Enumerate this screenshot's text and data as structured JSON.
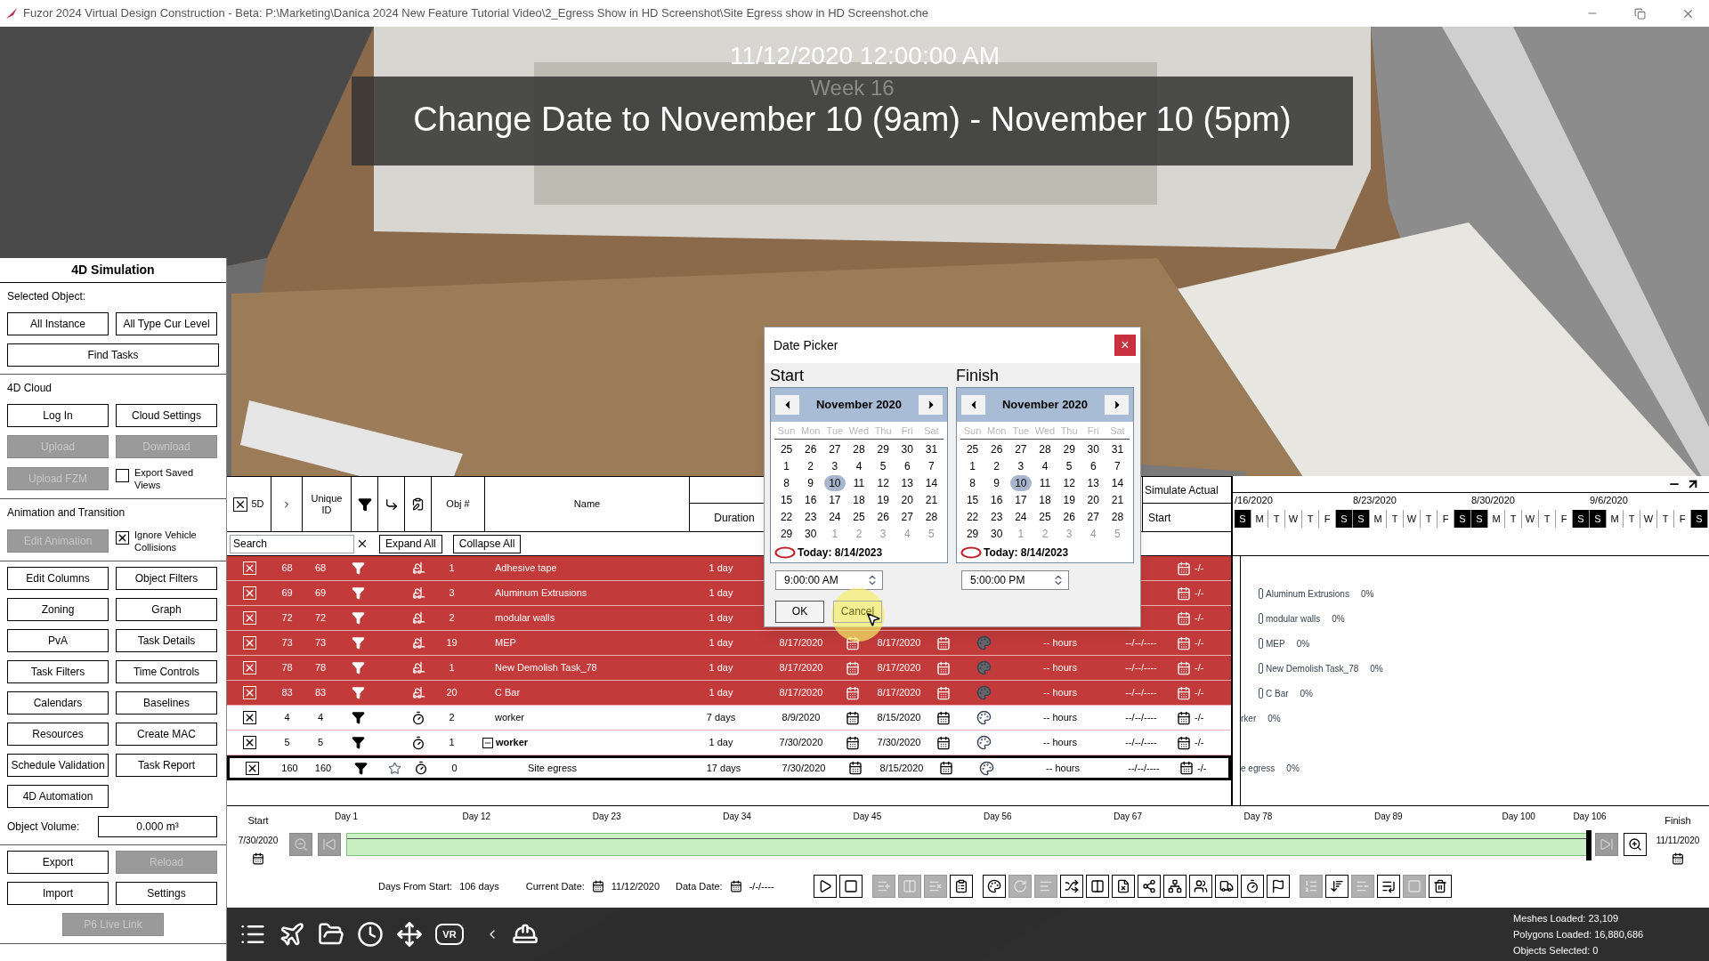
{
  "window": {
    "title": "Fuzor 2024 Virtual Design Construction - Beta: P:\\Marketing\\Danica 2024 New Feature Tutorial Video\\2_Egress Show in HD Screenshot\\Site Egress show in HD Screenshot.che"
  },
  "viewport": {
    "date": "11/12/2020 12:00:00 AM",
    "week": "Week 16",
    "banner": "Change Date to November 10 (9am) - November 10 (5pm)"
  },
  "left_panel": {
    "title": "4D Simulation",
    "sections": [
      {
        "heading": "Selected Object:",
        "rows": [
          {
            "items": [
              {
                "kind": "button",
                "label": "All Instance",
                "disabled": false
              },
              {
                "kind": "button",
                "label": "All Type Cur Level",
                "disabled": false
              }
            ]
          },
          {
            "items": [
              {
                "kind": "wide-button",
                "label": "Find Tasks",
                "disabled": false
              }
            ]
          }
        ]
      },
      {
        "heading": "4D Cloud",
        "rows": [
          {
            "items": [
              {
                "kind": "button",
                "label": "Log In",
                "disabled": false
              },
              {
                "kind": "button",
                "label": "Cloud Settings",
                "disabled": false
              }
            ]
          },
          {
            "items": [
              {
                "kind": "button",
                "label": "Upload",
                "disabled": true
              },
              {
                "kind": "button",
                "label": "Download",
                "disabled": true
              }
            ]
          },
          {
            "items": [
              {
                "kind": "button",
                "label": "Upload FZM",
                "disabled": true
              },
              {
                "kind": "checkbox",
                "label": "Export Saved Views",
                "checked": false
              }
            ]
          }
        ]
      },
      {
        "heading": "Animation and Transition",
        "rows": [
          {
            "items": [
              {
                "kind": "button",
                "label": "Edit Animation",
                "disabled": true
              },
              {
                "kind": "checkbox",
                "label": "Ignore Vehicle Collisions",
                "checked": true
              }
            ]
          }
        ]
      },
      {
        "rows": [
          {
            "items": [
              {
                "kind": "button",
                "label": "Edit Columns",
                "disabled": false
              },
              {
                "kind": "button",
                "label": "Object Filters",
                "disabled": false
              }
            ]
          },
          {
            "items": [
              {
                "kind": "button",
                "label": "Zoning",
                "disabled": false
              },
              {
                "kind": "button",
                "label": "Graph",
                "disabled": false
              }
            ]
          },
          {
            "items": [
              {
                "kind": "button",
                "label": "PvA",
                "disabled": false
              },
              {
                "kind": "button",
                "label": "Task Details",
                "disabled": false
              }
            ]
          },
          {
            "items": [
              {
                "kind": "button",
                "label": "Task Filters",
                "disabled": false
              },
              {
                "kind": "button",
                "label": "Time Controls",
                "disabled": false
              }
            ]
          },
          {
            "items": [
              {
                "kind": "button",
                "label": "Calendars",
                "disabled": false
              },
              {
                "kind": "button",
                "label": "Baselines",
                "disabled": false
              }
            ]
          },
          {
            "items": [
              {
                "kind": "button",
                "label": "Resources",
                "disabled": false
              },
              {
                "kind": "button",
                "label": "Create MAC",
                "disabled": false
              }
            ]
          },
          {
            "items": [
              {
                "kind": "button",
                "label": "Schedule Validation",
                "disabled": false
              },
              {
                "kind": "button",
                "label": "Task Report",
                "disabled": false
              }
            ]
          },
          {
            "items": [
              {
                "kind": "button",
                "label": "4D Automation",
                "disabled": false
              }
            ]
          },
          {
            "items": [
              {
                "kind": "label",
                "label": "Object Volume:"
              },
              {
                "kind": "field",
                "value": "0.000 m³"
              }
            ]
          }
        ]
      },
      {
        "rows": [
          {
            "items": [
              {
                "kind": "button",
                "label": "Export",
                "disabled": false
              },
              {
                "kind": "button",
                "label": "Reload",
                "disabled": true
              }
            ]
          },
          {
            "items": [
              {
                "kind": "button",
                "label": "Import",
                "disabled": false
              },
              {
                "kind": "button",
                "label": "Settings",
                "disabled": false
              }
            ]
          },
          {
            "items": [
              {
                "kind": "centered-button",
                "label": "P6 Live Link",
                "disabled": true
              }
            ]
          }
        ]
      }
    ]
  },
  "table": {
    "header": {
      "checked": true,
      "col_5d": "5D",
      "unique_id": "Unique ID",
      "obj": "Obj #",
      "name": "Name",
      "duration": "Duration",
      "simulate_actual": "Simulate Actual",
      "start": "Start"
    },
    "search": {
      "placeholder": "Search"
    },
    "expand_all": "Expand All",
    "collapse_all": "Collapse All",
    "rows": [
      {
        "checked": true,
        "id": "68",
        "uid": "68",
        "kind": "equipment",
        "obj": "1",
        "name": "Adhesive tape",
        "duration": "1 day",
        "color": "#c23a3a",
        "selected": false,
        "tail": "-/-"
      },
      {
        "checked": true,
        "id": "69",
        "uid": "69",
        "kind": "equipment",
        "obj": "3",
        "name": "Aluminum Extrusions",
        "duration": "1 day",
        "color": "#c23a3a",
        "selected": false,
        "tail": "-/-",
        "gantt": {
          "label": "Aluminum Extrusions",
          "percent": "0%",
          "bar": true
        }
      },
      {
        "checked": true,
        "id": "72",
        "uid": "72",
        "kind": "equipment",
        "obj": "2",
        "name": "modular walls",
        "duration": "1 day",
        "color": "#c23a3a",
        "selected": false,
        "tail": "-/-",
        "gantt": {
          "label": "modular walls",
          "percent": "0%",
          "bar": true
        }
      },
      {
        "checked": true,
        "id": "73",
        "uid": "73",
        "kind": "equipment",
        "obj": "19",
        "name": "MEP",
        "duration": "1 day",
        "start": "8/17/2020",
        "finish": "8/17/2020",
        "hours": "-- hours",
        "actual": "--/--/----",
        "color": "#c23a3a",
        "selected": false,
        "tail": "-/-",
        "gantt": {
          "label": "MEP",
          "percent": "0%",
          "bar": true
        }
      },
      {
        "checked": true,
        "id": "78",
        "uid": "78",
        "kind": "equipment",
        "obj": "1",
        "name": "New Demolish Task_78",
        "duration": "1 day",
        "start": "8/17/2020",
        "finish": "8/17/2020",
        "hours": "-- hours",
        "actual": "--/--/----",
        "color": "#c23a3a",
        "selected": false,
        "tail": "-/-",
        "gantt": {
          "label": "New Demolish Task_78",
          "percent": "0%",
          "bar": true
        }
      },
      {
        "checked": true,
        "id": "83",
        "uid": "83",
        "kind": "equipment",
        "obj": "20",
        "name": "C Bar",
        "duration": "1 day",
        "start": "8/17/2020",
        "finish": "8/17/2020",
        "hours": "-- hours",
        "actual": "--/--/----",
        "color": "#c23a3a",
        "selected": false,
        "tail": "-/-",
        "gantt": {
          "label": "C Bar",
          "percent": "0%",
          "bar": true
        }
      },
      {
        "checked": true,
        "id": "4",
        "uid": "4",
        "kind": "labor",
        "obj": "2",
        "name": "worker",
        "duration": "7 days",
        "start": "8/9/2020",
        "finish": "8/15/2020",
        "hours": "-- hours",
        "actual": "--/--/----",
        "color": "#ffffff",
        "selected": false,
        "tail": "-/-",
        "gantt": {
          "label": "rker",
          "percent": "0%",
          "bar": false
        }
      },
      {
        "checked": true,
        "id": "5",
        "uid": "5",
        "kind": "labor",
        "obj": "1",
        "name": "worker",
        "duration": "1 day",
        "start": "7/30/2020",
        "finish": "7/30/2020",
        "hours": "-- hours",
        "actual": "--/--/----",
        "color": "#ffffff",
        "selected": false,
        "tail": "-/-",
        "expanded": true,
        "children": [
          {
            "checked": true,
            "id": "160",
            "uid": "160",
            "kind": "labor",
            "obj": "0",
            "name": "Site egress",
            "duration": "17 days",
            "start": "7/30/2020",
            "finish": "8/15/2020",
            "hours": "-- hours",
            "actual": "--/--/----",
            "color": "#ffffff",
            "selected": true,
            "tail": "-/-",
            "gantt": {
              "label": "e egress",
              "percent": "0%",
              "bar": false
            }
          }
        ]
      }
    ]
  },
  "gantt": {
    "dates": [
      "/16/2020",
      "8/23/2020",
      "8/30/2020",
      "9/6/2020"
    ],
    "days": [
      {
        "letter": "S",
        "weekend": true
      },
      {
        "letter": "M",
        "weekend": false
      },
      {
        "letter": "T",
        "weekend": false
      },
      {
        "letter": "W",
        "weekend": false
      },
      {
        "letter": "T",
        "weekend": false
      },
      {
        "letter": "F",
        "weekend": false
      },
      {
        "letter": "S",
        "weekend": true
      },
      {
        "letter": "S",
        "weekend": true
      },
      {
        "letter": "M",
        "weekend": false
      },
      {
        "letter": "T",
        "weekend": false
      },
      {
        "letter": "W",
        "weekend": false
      },
      {
        "letter": "T",
        "weekend": false
      },
      {
        "letter": "F",
        "weekend": false
      },
      {
        "letter": "S",
        "weekend": true
      },
      {
        "letter": "S",
        "weekend": true
      },
      {
        "letter": "M",
        "weekend": false
      },
      {
        "letter": "T",
        "weekend": false
      },
      {
        "letter": "W",
        "weekend": false
      },
      {
        "letter": "T",
        "weekend": false
      },
      {
        "letter": "F",
        "weekend": false
      },
      {
        "letter": "S",
        "weekend": true
      },
      {
        "letter": "S",
        "weekend": true
      },
      {
        "letter": "M",
        "weekend": false
      },
      {
        "letter": "T",
        "weekend": false
      },
      {
        "letter": "W",
        "weekend": false
      },
      {
        "letter": "T",
        "weekend": false
      },
      {
        "letter": "F",
        "weekend": false
      },
      {
        "letter": "S",
        "weekend": true
      }
    ]
  },
  "timeline": {
    "start_label": "Start",
    "start_date": "7/30/2020",
    "finish_label": "Finish",
    "finish_date": "11/11/2020",
    "level": 1,
    "ticks": [
      "Day 1",
      "Day 12",
      "Day 23",
      "Day 34",
      "Day 45",
      "Day 56",
      "Day 67",
      "Day 78",
      "Day 89",
      "Day 100",
      "Day 106"
    ],
    "nav": [
      {
        "kind": "zoom-out",
        "disabled": true
      },
      {
        "kind": "first",
        "disabled": true
      },
      {
        "kind": "last",
        "disabled": true
      },
      {
        "kind": "zoom-in",
        "disabled": false
      }
    ],
    "days_label": "Days From Start:",
    "days_value": "106 days",
    "current_label": "Current Date:",
    "current_value": "11/12/2020",
    "data_label": "Data Date:",
    "data_value": "-/-/----"
  },
  "toolbar": [
    {
      "kind": "play",
      "disabled": false
    },
    {
      "kind": "stop",
      "disabled": false
    },
    {
      "kind": "add-row",
      "disabled": true
    },
    {
      "kind": "remove-row",
      "disabled": true
    },
    {
      "kind": "delete-row",
      "disabled": true
    },
    {
      "kind": "task-list",
      "disabled": false
    },
    {
      "kind": "palette",
      "disabled": false
    },
    {
      "kind": "refresh",
      "disabled": true
    },
    {
      "kind": "lines",
      "disabled": true
    },
    {
      "kind": "shuffle",
      "disabled": false
    },
    {
      "kind": "columns",
      "disabled": false
    },
    {
      "kind": "file-x",
      "disabled": false
    },
    {
      "kind": "share",
      "disabled": false
    },
    {
      "kind": "network",
      "disabled": false
    },
    {
      "kind": "users",
      "disabled": false
    },
    {
      "kind": "truck",
      "disabled": false
    },
    {
      "kind": "timer",
      "disabled": false
    },
    {
      "kind": "flag",
      "disabled": false
    },
    {
      "kind": "ordered",
      "disabled": true
    },
    {
      "kind": "sort",
      "disabled": false
    },
    {
      "kind": "list-minus",
      "disabled": true
    },
    {
      "kind": "list-end",
      "disabled": false
    },
    {
      "kind": "square",
      "disabled": true
    },
    {
      "kind": "trash",
      "disabled": false
    }
  ],
  "bottom_bar": {
    "icons": [
      {
        "kind": "menu"
      },
      {
        "kind": "drone"
      },
      {
        "kind": "folder"
      },
      {
        "kind": "clock"
      },
      {
        "kind": "move"
      },
      {
        "kind": "vr",
        "text": "VR"
      },
      {
        "kind": "chevron"
      },
      {
        "kind": "helmet"
      }
    ],
    "stats": [
      "Meshes Loaded: 23,109",
      "Polygons Loaded: 16,880,686",
      "Objects Selected: 0"
    ]
  },
  "date_picker": {
    "title": "Date Picker",
    "close": "×",
    "ok": "OK",
    "cancel": "Cancel",
    "calendars": [
      {
        "label": "Start",
        "month": "November 2020",
        "today": "Today: 8/14/2023",
        "time": "9:00:00 AM",
        "weekdays": [
          "Sun",
          "Mon",
          "Tue",
          "Wed",
          "Thu",
          "Fri",
          "Sat"
        ],
        "days": [
          {
            "d": "25",
            "muted": false,
            "selected": false
          },
          {
            "d": "26",
            "muted": false,
            "selected": false
          },
          {
            "d": "27",
            "muted": false,
            "selected": false
          },
          {
            "d": "28",
            "muted": false,
            "selected": false
          },
          {
            "d": "29",
            "muted": false,
            "selected": false
          },
          {
            "d": "30",
            "muted": false,
            "selected": false
          },
          {
            "d": "31",
            "muted": false,
            "selected": false
          },
          {
            "d": "1",
            "muted": false,
            "selected": false
          },
          {
            "d": "2",
            "muted": false,
            "selected": false
          },
          {
            "d": "3",
            "muted": false,
            "selected": false
          },
          {
            "d": "4",
            "muted": false,
            "selected": false
          },
          {
            "d": "5",
            "muted": false,
            "selected": false
          },
          {
            "d": "6",
            "muted": false,
            "selected": false
          },
          {
            "d": "7",
            "muted": false,
            "selected": false
          },
          {
            "d": "8",
            "muted": false,
            "selected": false
          },
          {
            "d": "9",
            "muted": false,
            "selected": false
          },
          {
            "d": "10",
            "muted": false,
            "selected": true
          },
          {
            "d": "11",
            "muted": false,
            "selected": false
          },
          {
            "d": "12",
            "muted": false,
            "selected": false
          },
          {
            "d": "13",
            "muted": false,
            "selected": false
          },
          {
            "d": "14",
            "muted": false,
            "selected": false
          },
          {
            "d": "15",
            "muted": false,
            "selected": false
          },
          {
            "d": "16",
            "muted": false,
            "selected": false
          },
          {
            "d": "17",
            "muted": false,
            "selected": false
          },
          {
            "d": "18",
            "muted": false,
            "selected": false
          },
          {
            "d": "19",
            "muted": false,
            "selected": false
          },
          {
            "d": "20",
            "muted": false,
            "selected": false
          },
          {
            "d": "21",
            "muted": false,
            "selected": false
          },
          {
            "d": "22",
            "muted": false,
            "selected": false
          },
          {
            "d": "23",
            "muted": false,
            "selected": false
          },
          {
            "d": "24",
            "muted": false,
            "selected": false
          },
          {
            "d": "25",
            "muted": false,
            "selected": false
          },
          {
            "d": "26",
            "muted": false,
            "selected": false
          },
          {
            "d": "27",
            "muted": false,
            "selected": false
          },
          {
            "d": "28",
            "muted": false,
            "selected": false
          },
          {
            "d": "29",
            "muted": false,
            "selected": false
          },
          {
            "d": "30",
            "muted": false,
            "selected": false
          },
          {
            "d": "1",
            "muted": true,
            "selected": false
          },
          {
            "d": "2",
            "muted": true,
            "selected": false
          },
          {
            "d": "3",
            "muted": true,
            "selected": false
          },
          {
            "d": "4",
            "muted": true,
            "selected": false
          },
          {
            "d": "5",
            "muted": true,
            "selected": false
          }
        ]
      },
      {
        "label": "Finish",
        "month": "November 2020",
        "today": "Today: 8/14/2023",
        "time": "5:00:00 PM",
        "weekdays": [
          "Sun",
          "Mon",
          "Tue",
          "Wed",
          "Thu",
          "Fri",
          "Sat"
        ],
        "days": [
          {
            "d": "25",
            "muted": false,
            "selected": false
          },
          {
            "d": "26",
            "muted": false,
            "selected": false
          },
          {
            "d": "27",
            "muted": false,
            "selected": false
          },
          {
            "d": "28",
            "muted": false,
            "selected": false
          },
          {
            "d": "29",
            "muted": false,
            "selected": false
          },
          {
            "d": "30",
            "muted": false,
            "selected": false
          },
          {
            "d": "31",
            "muted": false,
            "selected": false
          },
          {
            "d": "1",
            "muted": false,
            "selected": false
          },
          {
            "d": "2",
            "muted": false,
            "selected": false
          },
          {
            "d": "3",
            "muted": false,
            "selected": false
          },
          {
            "d": "4",
            "muted": false,
            "selected": false
          },
          {
            "d": "5",
            "muted": false,
            "selected": false
          },
          {
            "d": "6",
            "muted": false,
            "selected": false
          },
          {
            "d": "7",
            "muted": false,
            "selected": false
          },
          {
            "d": "8",
            "muted": false,
            "selected": false
          },
          {
            "d": "9",
            "muted": false,
            "selected": false
          },
          {
            "d": "10",
            "muted": false,
            "selected": true
          },
          {
            "d": "11",
            "muted": false,
            "selected": false
          },
          {
            "d": "12",
            "muted": false,
            "selected": false
          },
          {
            "d": "13",
            "muted": false,
            "selected": false
          },
          {
            "d": "14",
            "muted": false,
            "selected": false
          },
          {
            "d": "15",
            "muted": false,
            "selected": false
          },
          {
            "d": "16",
            "muted": false,
            "selected": false
          },
          {
            "d": "17",
            "muted": false,
            "selected": false
          },
          {
            "d": "18",
            "muted": false,
            "selected": false
          },
          {
            "d": "19",
            "muted": false,
            "selected": false
          },
          {
            "d": "20",
            "muted": false,
            "selected": false
          },
          {
            "d": "21",
            "muted": false,
            "selected": false
          },
          {
            "d": "22",
            "muted": false,
            "selected": false
          },
          {
            "d": "23",
            "muted": false,
            "selected": false
          },
          {
            "d": "24",
            "muted": false,
            "selected": false
          },
          {
            "d": "25",
            "muted": false,
            "selected": false
          },
          {
            "d": "26",
            "muted": false,
            "selected": false
          },
          {
            "d": "27",
            "muted": false,
            "selected": false
          },
          {
            "d": "28",
            "muted": false,
            "selected": false
          },
          {
            "d": "29",
            "muted": false,
            "selected": false
          },
          {
            "d": "30",
            "muted": false,
            "selected": false
          },
          {
            "d": "1",
            "muted": true,
            "selected": false
          },
          {
            "d": "2",
            "muted": true,
            "selected": false
          },
          {
            "d": "3",
            "muted": true,
            "selected": false
          },
          {
            "d": "4",
            "muted": true,
            "selected": false
          },
          {
            "d": "5",
            "muted": true,
            "selected": false
          }
        ]
      }
    ]
  }
}
